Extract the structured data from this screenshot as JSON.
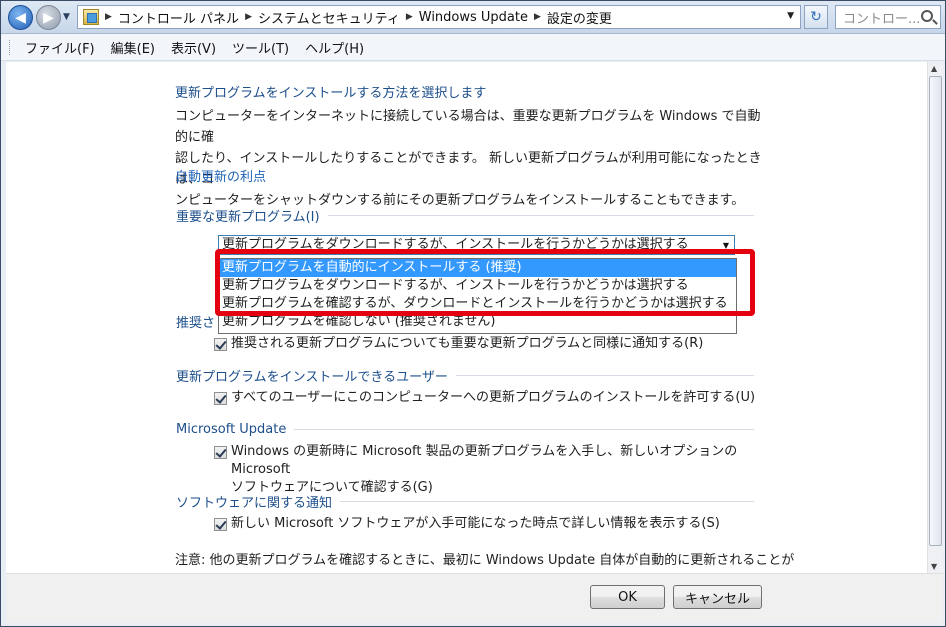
{
  "address_bar": {
    "breadcrumbs": [
      "コントロール パネル",
      "システムとセキュリティ",
      "Windows Update",
      "設定の変更"
    ],
    "search_placeholder": "コントロー..."
  },
  "menu": [
    "ファイル(F)",
    "編集(E)",
    "表示(V)",
    "ツール(T)",
    "ヘルプ(H)"
  ],
  "content": {
    "heading": "更新プログラムをインストールする方法を選択します",
    "intro_lines": [
      "コンピューターをインターネットに接続している場合は、重要な更新プログラムを Windows で自動的に確",
      "認したり、インストールしたりすることができます。 新しい更新プログラムが利用可能になったときは、コ",
      "ンピューターをシャットダウンする前にその更新プログラムをインストールすることもできます。"
    ],
    "benefits_link": "自動更新の利点",
    "important_updates": {
      "label": "重要な更新プログラム(I)",
      "selected": "更新プログラムをダウンロードするが、インストールを行うかどうかは選択する",
      "options": [
        "更新プログラムを自動的にインストールする (推奨)",
        "更新プログラムをダウンロードするが、インストールを行うかどうかは選択する",
        "更新プログラムを確認するが、ダウンロードとインストールを行うかどうかは選択する",
        "更新プログラムを確認しない (推奨されません)"
      ],
      "highlighted_option_index": 0
    },
    "recommended": {
      "label_partial": "推奨さ",
      "checkbox": "推奨される更新プログラムについても重要な更新プログラムと同様に通知する(R)",
      "checked": true
    },
    "who_can_install": {
      "label": "更新プログラムをインストールできるユーザー",
      "checkbox": "すべてのユーザーにこのコンピューターへの更新プログラムのインストールを許可する(U)",
      "checked": true
    },
    "microsoft_update": {
      "label": "Microsoft Update",
      "checkbox_lines": [
        "Windows の更新時に Microsoft 製品の更新プログラムを入手し、新しいオプションの Microsoft",
        "ソフトウェアについて確認する(G)"
      ],
      "checked": true
    },
    "software_notifications": {
      "label": "ソフトウェアに関する通知",
      "checkbox": "新しい Microsoft ソフトウェアが入手可能になった時点で詳しい情報を表示する(S)",
      "checked": true
    },
    "note": "注意: 他の更新プログラムを確認するときに、最初に Windows Update 自体が自動的に更新されることが"
  },
  "footer": {
    "ok": "OK",
    "cancel": "キャンセル"
  },
  "colors": {
    "highlight_box": "#e5000f",
    "selection": "#3399ff",
    "link": "#1c4e8c"
  }
}
